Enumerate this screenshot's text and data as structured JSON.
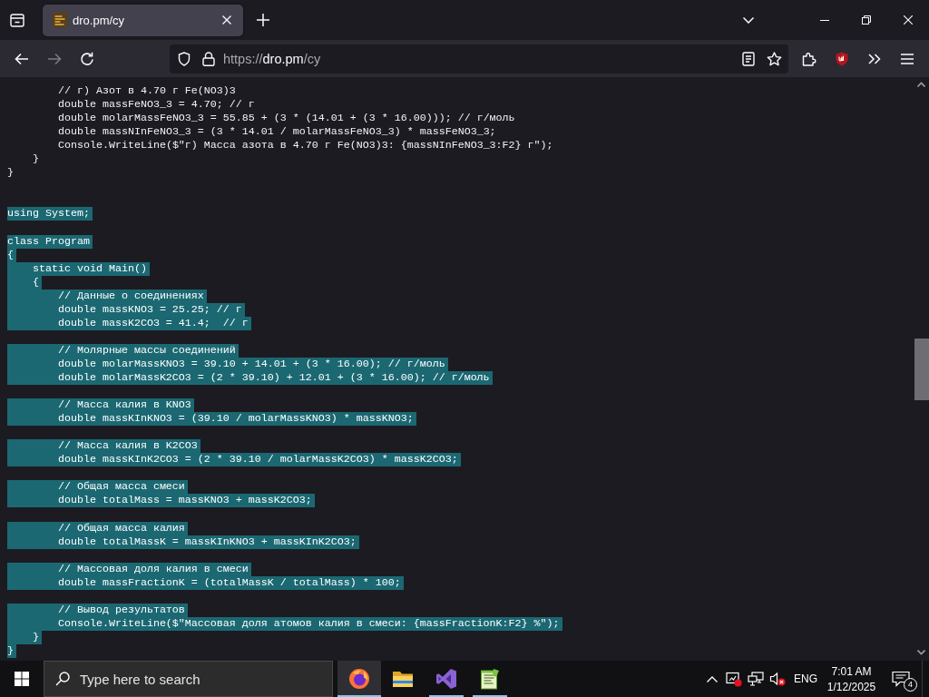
{
  "browser": {
    "tabs": [
      {
        "title": "dro.pm/cy",
        "selected": true
      }
    ],
    "nav_buttons": [
      {
        "kind": "back",
        "disabled": false
      },
      {
        "kind": "forward",
        "disabled": true
      },
      {
        "kind": "reload",
        "disabled": false
      }
    ],
    "url": {
      "scheme": "https://",
      "host": "dro.pm",
      "path": "/cy"
    }
  },
  "code": {
    "lines": [
      {
        "kind": "text",
        "text": "        // г) Азот в 4.70 г Fe(NO3)3",
        "selected": false
      },
      {
        "kind": "text",
        "text": "        double massFeNO3_3 = 4.70; // г",
        "selected": false
      },
      {
        "kind": "text",
        "text": "        double molarMassFeNO3_3 = 55.85 + (3 * (14.01 + (3 * 16.00))); // г/моль",
        "selected": false
      },
      {
        "kind": "text",
        "text": "        double massNInFeNO3_3 = (3 * 14.01 / molarMassFeNO3_3) * massFeNO3_3;",
        "selected": false
      },
      {
        "kind": "text",
        "text": "        Console.WriteLine($\"г) Масса азота в 4.70 г Fe(NO3)3: {massNInFeNO3_3:F2} г\");",
        "selected": false
      },
      {
        "kind": "text",
        "text": "    }",
        "selected": false
      },
      {
        "kind": "text",
        "text": "}",
        "selected": false
      },
      {
        "kind": "blank"
      },
      {
        "kind": "blank"
      },
      {
        "kind": "text",
        "text": "using System;",
        "selected": true
      },
      {
        "kind": "blank"
      },
      {
        "kind": "text",
        "text": "class Program",
        "selected": true
      },
      {
        "kind": "text",
        "text": "{",
        "selected": true
      },
      {
        "kind": "text",
        "text": "    static void Main()",
        "selected": true
      },
      {
        "kind": "text",
        "text": "    {",
        "selected": true
      },
      {
        "kind": "text",
        "text": "        // Данные о соединениях",
        "selected": true
      },
      {
        "kind": "text",
        "text": "        double massKNO3 = 25.25; // г",
        "selected": true
      },
      {
        "kind": "text",
        "text": "        double massK2CO3 = 41.4;  // г",
        "selected": true
      },
      {
        "kind": "blank"
      },
      {
        "kind": "text",
        "text": "        // Молярные массы соединений",
        "selected": true
      },
      {
        "kind": "text",
        "text": "        double molarMassKNO3 = 39.10 + 14.01 + (3 * 16.00); // г/моль",
        "selected": true
      },
      {
        "kind": "text",
        "text": "        double molarMassK2CO3 = (2 * 39.10) + 12.01 + (3 * 16.00); // г/моль",
        "selected": true
      },
      {
        "kind": "blank"
      },
      {
        "kind": "text",
        "text": "        // Масса калия в KNO3",
        "selected": true
      },
      {
        "kind": "text",
        "text": "        double massKInKNO3 = (39.10 / molarMassKNO3) * massKNO3;",
        "selected": true
      },
      {
        "kind": "blank"
      },
      {
        "kind": "text",
        "text": "        // Масса калия в K2CO3",
        "selected": true
      },
      {
        "kind": "text",
        "text": "        double massKInK2CO3 = (2 * 39.10 / molarMassK2CO3) * massK2CO3;",
        "selected": true
      },
      {
        "kind": "blank"
      },
      {
        "kind": "text",
        "text": "        // Общая масса смеси",
        "selected": true
      },
      {
        "kind": "text",
        "text": "        double totalMass = massKNO3 + massK2CO3;",
        "selected": true
      },
      {
        "kind": "blank"
      },
      {
        "kind": "text",
        "text": "        // Общая масса калия",
        "selected": true
      },
      {
        "kind": "text",
        "text": "        double totalMassK = massKInKNO3 + massKInK2CO3;",
        "selected": true
      },
      {
        "kind": "blank"
      },
      {
        "kind": "text",
        "text": "        // Массовая доля калия в смеси",
        "selected": true
      },
      {
        "kind": "text",
        "text": "        double massFractionK = (totalMassK / totalMass) * 100;",
        "selected": true
      },
      {
        "kind": "blank"
      },
      {
        "kind": "text",
        "text": "        // Вывод результатов",
        "selected": true
      },
      {
        "kind": "text",
        "text": "        Console.WriteLine($\"Массовая доля атомов калия в смеси: {massFractionK:F2} %\");",
        "selected": true
      },
      {
        "kind": "text",
        "text": "    }",
        "selected": true
      },
      {
        "kind": "text",
        "text": "}",
        "selected": true
      }
    ]
  },
  "taskbar": {
    "search": {
      "placeholder": "Type here to search"
    },
    "apps": [
      {
        "kind": "browser",
        "active": true,
        "running": true
      },
      {
        "kind": "folder",
        "active": false,
        "running": false
      },
      {
        "kind": "ide",
        "active": false,
        "running": true
      },
      {
        "kind": "notepad",
        "active": false,
        "running": true
      }
    ],
    "tray": {
      "volume_muted": true,
      "language": "ENG",
      "time": "7:01 AM",
      "date": "1/12/2025",
      "notification_count": "4"
    }
  }
}
